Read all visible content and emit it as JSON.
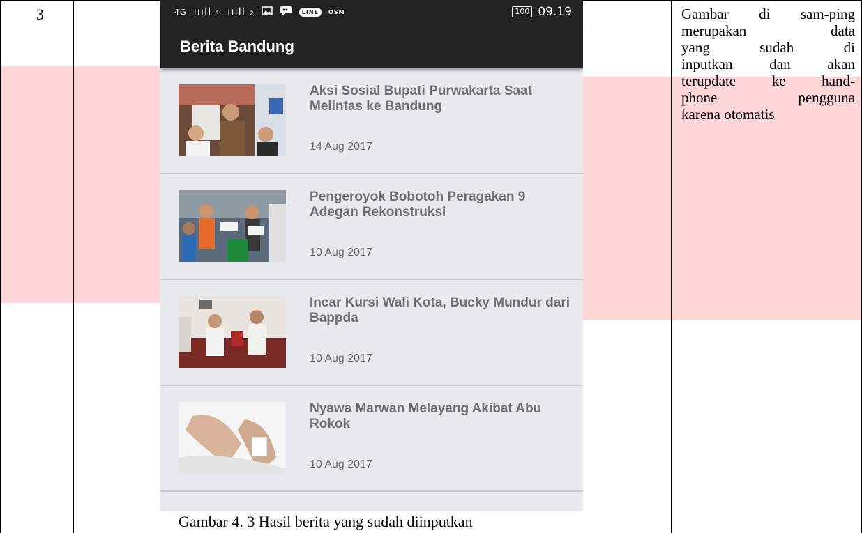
{
  "row": {
    "number": "3"
  },
  "phone": {
    "status": {
      "network": "4G",
      "signal1": "ıııll ₁",
      "signal2": "ıııll ₂",
      "line_badge": "LINE",
      "osm_badge": "OSM",
      "battery": "100",
      "time": "09.19"
    },
    "app_title": "Berita Bandung",
    "news": [
      {
        "title": "Aksi Sosial Bupati Purwakarta Saat Melintas ke Bandung",
        "date": "14 Aug 2017"
      },
      {
        "title": "Pengeroyok Bobotoh Peragakan 9 Adegan Rekonstruksi",
        "date": "10 Aug 2017"
      },
      {
        "title": "Incar Kursi Wali Kota, Bucky Mundur dari Bappda",
        "date": "10 Aug 2017"
      },
      {
        "title": "Nyawa Marwan Melayang Akibat Abu Rokok",
        "date": "10 Aug 2017"
      }
    ]
  },
  "caption": "Gambar 4. 3 Hasil berita yang sudah diinputkan",
  "description": {
    "lines": [
      "Gambar di sam-ping",
      "merupakan data",
      "yang sudah di",
      "inputkan dan akan",
      "terupdate ke hand-",
      "phone pengguna",
      "karena otomatis"
    ]
  },
  "colors": {
    "appbar": "#222222",
    "list_bg": "#e8eaed",
    "watermark": "#fdd7d7",
    "headline_text": "#6e6e6e"
  }
}
